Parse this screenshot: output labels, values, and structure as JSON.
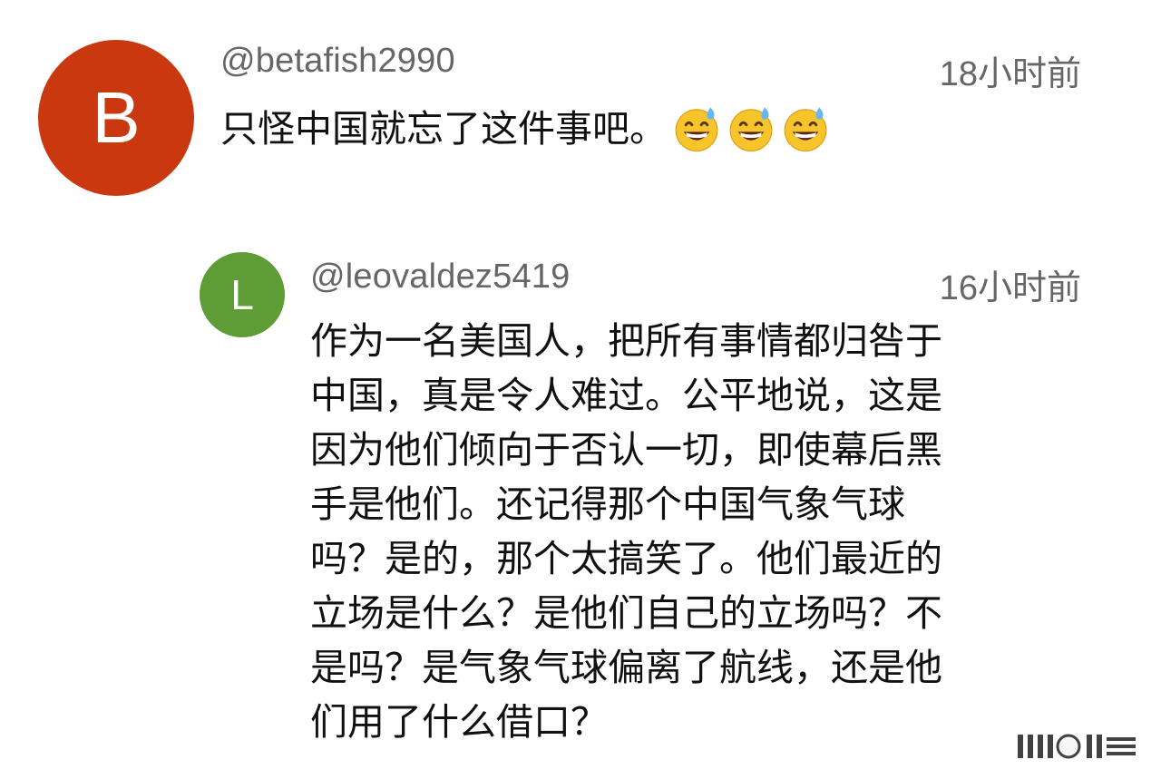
{
  "comments": [
    {
      "avatar_letter": "B",
      "avatar_color": "#c9380e",
      "username": "@betafish2990",
      "timestamp": "18小时前",
      "text": "只怪中国就忘了这件事吧。",
      "emojis": [
        "grinning-sweat-emoji",
        "grinning-sweat-emoji",
        "grinning-sweat-emoji"
      ]
    },
    {
      "avatar_letter": "L",
      "avatar_color": "#5e9c35",
      "username": "@leovaldez5419",
      "timestamp": "16小时前",
      "text": "作为一名美国人，把所有事情都归咎于\n中国，真是令人难过。公平地说，这是\n因为他们倾向于否认一切，即使幕后黑\n手是他们。还记得那个中国气象气球\n吗？是的，那个太搞笑了。他们最近的\n立场是什么？是他们自己的立场吗？不\n是吗？是气象气球偏离了航线，还是他\n们用了什么借口？"
    }
  ]
}
